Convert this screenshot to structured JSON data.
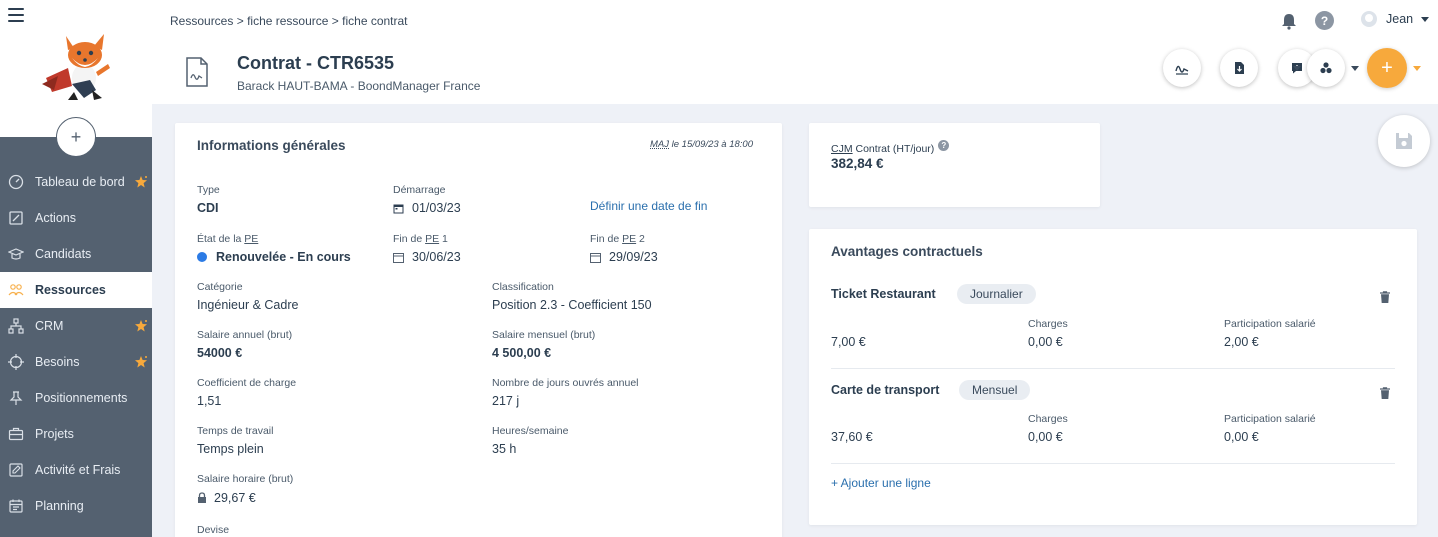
{
  "breadcrumb": {
    "item1": "Ressources",
    "sep1": ">",
    "item2": "fiche ressource",
    "sep2": ">",
    "item3": "fiche contrat"
  },
  "user": {
    "name": "Jean"
  },
  "help_glyph": "?",
  "header": {
    "title": "Contrat - CTR6535",
    "subtitle": "Barack HAUT-BAMA - BoondManager France"
  },
  "plus_glyph": "+",
  "sidebar": {
    "add_glyph": "+",
    "items": [
      {
        "label": "Tableau de bord",
        "icon": "dashboard-icon",
        "star": true
      },
      {
        "label": "Actions",
        "icon": "actions-icon",
        "star": false
      },
      {
        "label": "Candidats",
        "icon": "graduation-cap-icon",
        "star": false
      },
      {
        "label": "Ressources",
        "icon": "people-icon",
        "star": false,
        "active": true
      },
      {
        "label": "CRM",
        "icon": "network-icon",
        "star": true
      },
      {
        "label": "Besoins",
        "icon": "target-icon",
        "star": true
      },
      {
        "label": "Positionnements",
        "icon": "pin-icon",
        "star": false
      },
      {
        "label": "Projets",
        "icon": "briefcase-icon",
        "star": false
      },
      {
        "label": "Activité et Frais",
        "icon": "edit-icon",
        "star": false
      },
      {
        "label": "Planning",
        "icon": "calendar-icon",
        "star": false
      }
    ]
  },
  "info": {
    "title": "Informations générales",
    "maj_abbr": "MAJ",
    "maj_rest": " le 15/09/23 à 18:00",
    "type_label": "Type",
    "type_value": "CDI",
    "start_label": "Démarrage",
    "start_value": "01/03/23",
    "end_link": "Définir une date de fin",
    "state_label_pre": "État de la ",
    "state_label_abbr": "PE",
    "state_value": "Renouvelée - En cours",
    "pe1_label_pre": "Fin de ",
    "pe1_label_abbr": "PE",
    "pe1_label_post": " 1",
    "pe1_value": "30/06/23",
    "pe2_label_pre": "Fin de ",
    "pe2_label_abbr": "PE",
    "pe2_label_post": " 2",
    "pe2_value": "29/09/23",
    "cat_label": "Catégorie",
    "cat_value": "Ingénieur & Cadre",
    "class_label": "Classification",
    "class_value": "Position 2.3 - Coefficient 150",
    "sal_annual_label": "Salaire annuel (brut)",
    "sal_annual_value": "54000 €",
    "sal_month_label": "Salaire mensuel (brut)",
    "sal_month_value": "4 500,00 €",
    "coef_label": "Coefficient de charge",
    "coef_value": "1,51",
    "days_label": "Nombre de jours ouvrés annuel",
    "days_value": "217 j",
    "time_label": "Temps de travail",
    "time_value": "Temps plein",
    "hours_label": "Heures/semaine",
    "hours_value": "35 h",
    "hourly_label": "Salaire horaire (brut)",
    "hourly_value": "29,67 €",
    "currency_label": "Devise"
  },
  "cjm": {
    "label_abbr": "CJM",
    "label_rest": " Contrat (HT/jour)",
    "value": "382,84 €",
    "help_glyph": "?"
  },
  "avantages": {
    "title": "Avantages contractuels",
    "items": [
      {
        "name": "Ticket Restaurant",
        "period": "Journalier",
        "amount": "7,00 €",
        "charges_label": "Charges",
        "charges": "0,00 €",
        "part_label": "Participation salarié",
        "part": "2,00 €"
      },
      {
        "name": "Carte de transport",
        "period": "Mensuel",
        "amount": "37,60 €",
        "charges_label": "Charges",
        "charges": "0,00 €",
        "part_label": "Participation salarié",
        "part": "0,00 €"
      }
    ],
    "add_line": "+ Ajouter une ligne"
  },
  "colors": {
    "sidebar": "#546170",
    "accent": "#f7a93c",
    "link": "#2a6fad",
    "status_dot": "#2c7be5"
  }
}
